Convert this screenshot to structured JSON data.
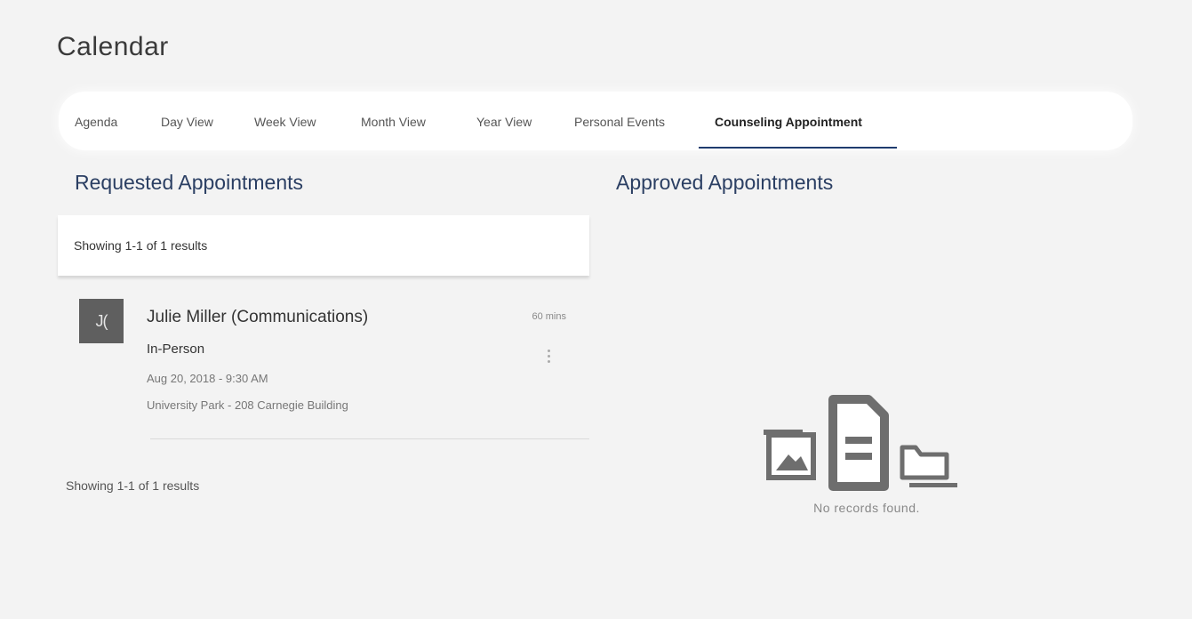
{
  "page": {
    "title": "Calendar"
  },
  "tabs": [
    {
      "label": "Agenda"
    },
    {
      "label": "Day View"
    },
    {
      "label": "Week View"
    },
    {
      "label": "Month View"
    },
    {
      "label": "Year View"
    },
    {
      "label": "Personal Events"
    },
    {
      "label": "Counseling Appointment",
      "active": true
    }
  ],
  "requested": {
    "title": "Requested Appointments",
    "results_top": "Showing 1-1 of 1 results",
    "results_bottom": "Showing 1-1 of 1 results",
    "items": [
      {
        "avatar_initials": "J(",
        "name": "Julie Miller (Communications)",
        "duration": "60 mins",
        "type": "In-Person",
        "datetime": "Aug 20, 2018 - 9:30 AM",
        "location": "University Park - 208 Carnegie Building"
      }
    ]
  },
  "approved": {
    "title": "Approved Appointments",
    "empty_text": "No records found.",
    "empty_icons": [
      "image-icon",
      "document-icon",
      "folder-icon"
    ]
  },
  "colors": {
    "accent": "#1f3c6e",
    "background": "#f3f3f3",
    "section_title": "#2b3f63",
    "avatar_bg": "#5f5f5f",
    "empty_icon": "#6e6e6e"
  }
}
